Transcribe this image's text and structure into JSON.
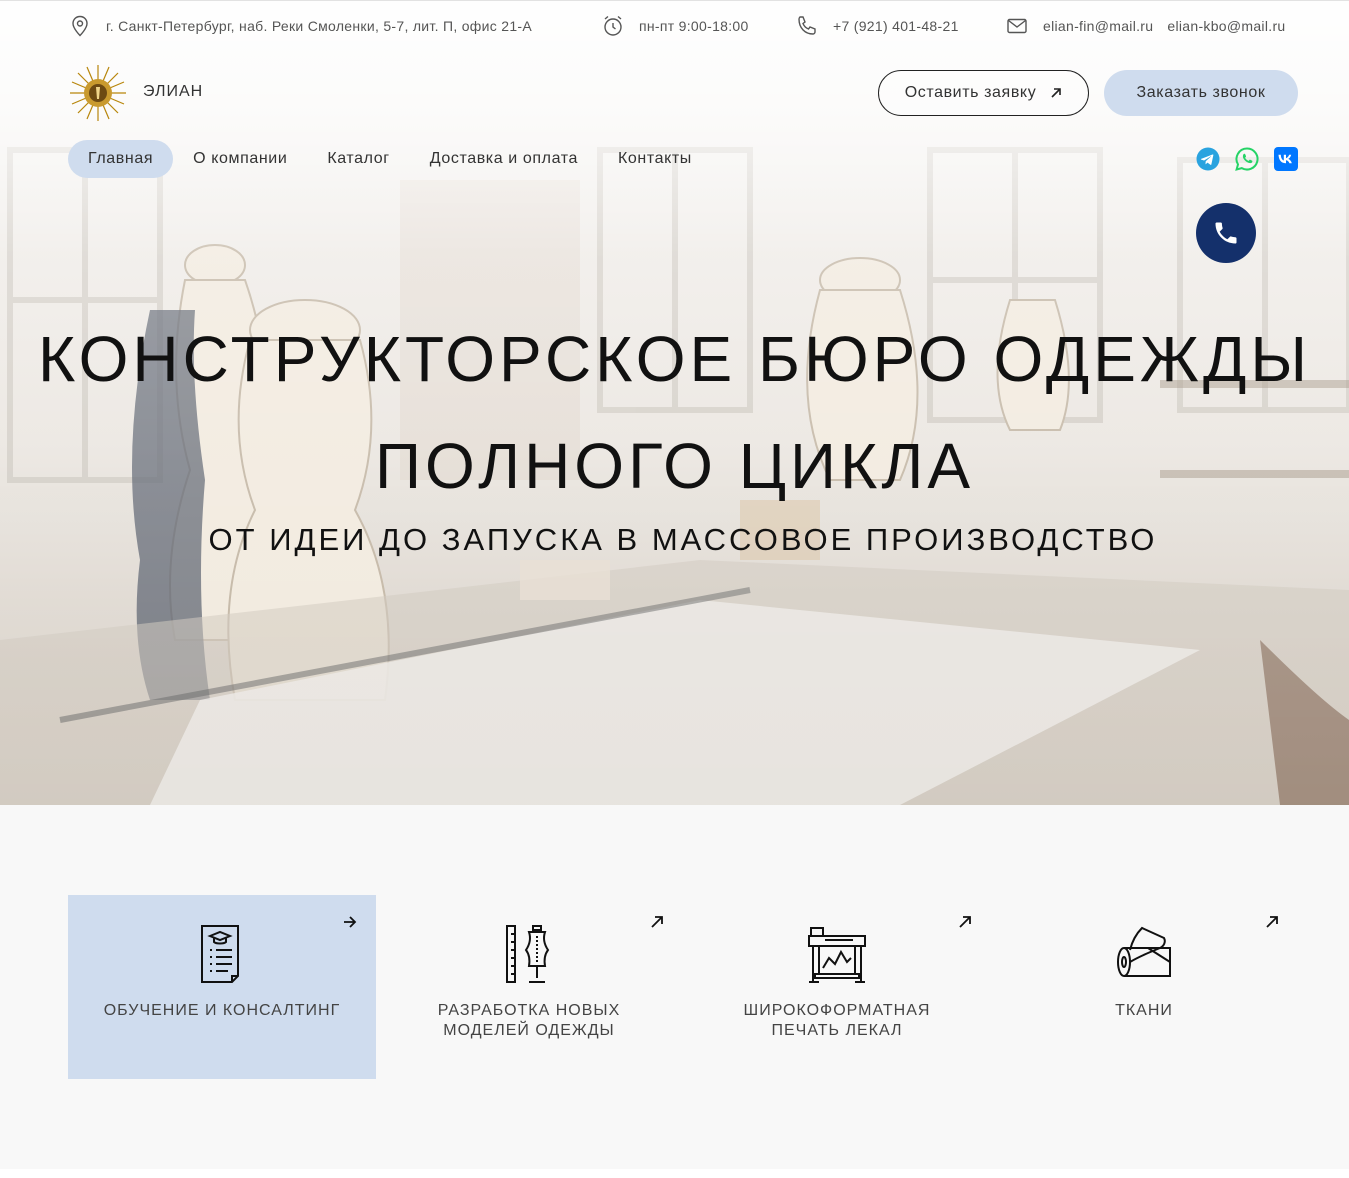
{
  "topbar": {
    "address": "г. Санкт-Петербург, наб. Реки Смоленки, 5-7, лит. П, офис 21-А",
    "hours": "пн-пт 9:00-18:00",
    "phone": "+7 (921) 401-48-21",
    "email_1": "elian-fin@mail.ru",
    "email_2": "elian-kbo@mail.ru"
  },
  "header": {
    "brand": "ЭЛИАН",
    "request_button": "Оставить заявку",
    "callback_button": "Заказать звонок"
  },
  "nav": {
    "items": [
      {
        "label": "Главная",
        "active": true
      },
      {
        "label": "О компании"
      },
      {
        "label": "Каталог"
      },
      {
        "label": "Доставка и оплата"
      },
      {
        "label": "Контакты"
      }
    ]
  },
  "social": {
    "icons": [
      "telegram-icon",
      "whatsapp-icon",
      "vk-icon"
    ],
    "colors": {
      "telegram": "#2aa3df",
      "whatsapp": "#25d366",
      "vk": "#0077ff"
    }
  },
  "hero": {
    "title_line_1": "КОНСТРУКТОРСКОЕ БЮРО ОДЕЖДЫ",
    "title_line_2": "ПОЛНОГО ЦИКЛА",
    "subtitle": "ОТ ИДЕИ ДО ЗАПУСКА В МАССОВОЕ ПРОИЗВОДСТВО"
  },
  "services": {
    "cards": [
      {
        "label": "Обучение и консалтинг",
        "icon": "training-document-icon",
        "active": true
      },
      {
        "label": "Разработка новых\nмоделей одежды",
        "icon": "tailor-mannequin-icon"
      },
      {
        "label": "Широкоформатная\nпечать лекал",
        "icon": "plotter-printer-icon"
      },
      {
        "label": "Ткани",
        "icon": "fabric-roll-icon"
      }
    ]
  },
  "colors": {
    "accent_light": "#cfdcee",
    "accent_dark": "#14306b",
    "section_bg": "#f8f8f8"
  }
}
